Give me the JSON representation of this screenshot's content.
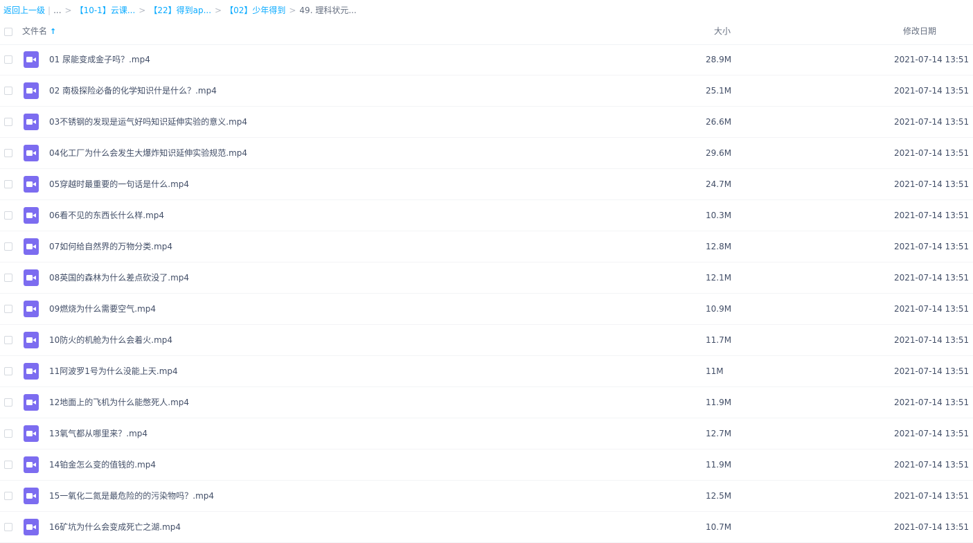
{
  "breadcrumb": {
    "back": "返回上一级",
    "ellipsis": "...",
    "separator": ">",
    "crumbs": [
      "【10-1】云课...",
      "【22】得到ap...",
      "【02】少年得到"
    ],
    "current": "49. 理科状元..."
  },
  "header": {
    "name": "文件名",
    "sort_icon": "arrow-up-icon",
    "size": "大小",
    "modified": "修改日期"
  },
  "file_icon": "video-file-icon",
  "accent_color": "#09aaff",
  "icon_color": "#7c6cf0",
  "files": [
    {
      "name": "01 尿能变成金子吗？.mp4",
      "size": "28.9M",
      "date": "2021-07-14 13:51"
    },
    {
      "name": "02 南极探险必备的化学知识什是什么？.mp4",
      "size": "25.1M",
      "date": "2021-07-14 13:51"
    },
    {
      "name": "03不锈钢的发现是运气好吗知识延伸实验的意义.mp4",
      "size": "26.6M",
      "date": "2021-07-14 13:51"
    },
    {
      "name": "04化工厂为什么会发生大爆炸知识延伸实验规范.mp4",
      "size": "29.6M",
      "date": "2021-07-14 13:51"
    },
    {
      "name": "05穿越时最重要的一句话是什么.mp4",
      "size": "24.7M",
      "date": "2021-07-14 13:51"
    },
    {
      "name": "06看不见的东西长什么样.mp4",
      "size": "10.3M",
      "date": "2021-07-14 13:51"
    },
    {
      "name": "07如何给自然界的万物分类.mp4",
      "size": "12.8M",
      "date": "2021-07-14 13:51"
    },
    {
      "name": "08英国的森林为什么差点砍没了.mp4",
      "size": "12.1M",
      "date": "2021-07-14 13:51"
    },
    {
      "name": "09燃烧为什么需要空气.mp4",
      "size": "10.9M",
      "date": "2021-07-14 13:51"
    },
    {
      "name": "10防火的机舱为什么会着火.mp4",
      "size": "11.7M",
      "date": "2021-07-14 13:51"
    },
    {
      "name": "11阿波罗1号为什么没能上天.mp4",
      "size": "11M",
      "date": "2021-07-14 13:51"
    },
    {
      "name": "12地面上的飞机为什么能憋死人.mp4",
      "size": "11.9M",
      "date": "2021-07-14 13:51"
    },
    {
      "name": "13氧气都从哪里来？.mp4",
      "size": "12.7M",
      "date": "2021-07-14 13:51"
    },
    {
      "name": "14铂金怎么变的值钱的.mp4",
      "size": "11.9M",
      "date": "2021-07-14 13:51"
    },
    {
      "name": "15一氧化二氮是最危险的的污染物吗？.mp4",
      "size": "12.5M",
      "date": "2021-07-14 13:51"
    },
    {
      "name": "16矿坑为什么会变成死亡之湖.mp4",
      "size": "10.7M",
      "date": "2021-07-14 13:51"
    }
  ]
}
